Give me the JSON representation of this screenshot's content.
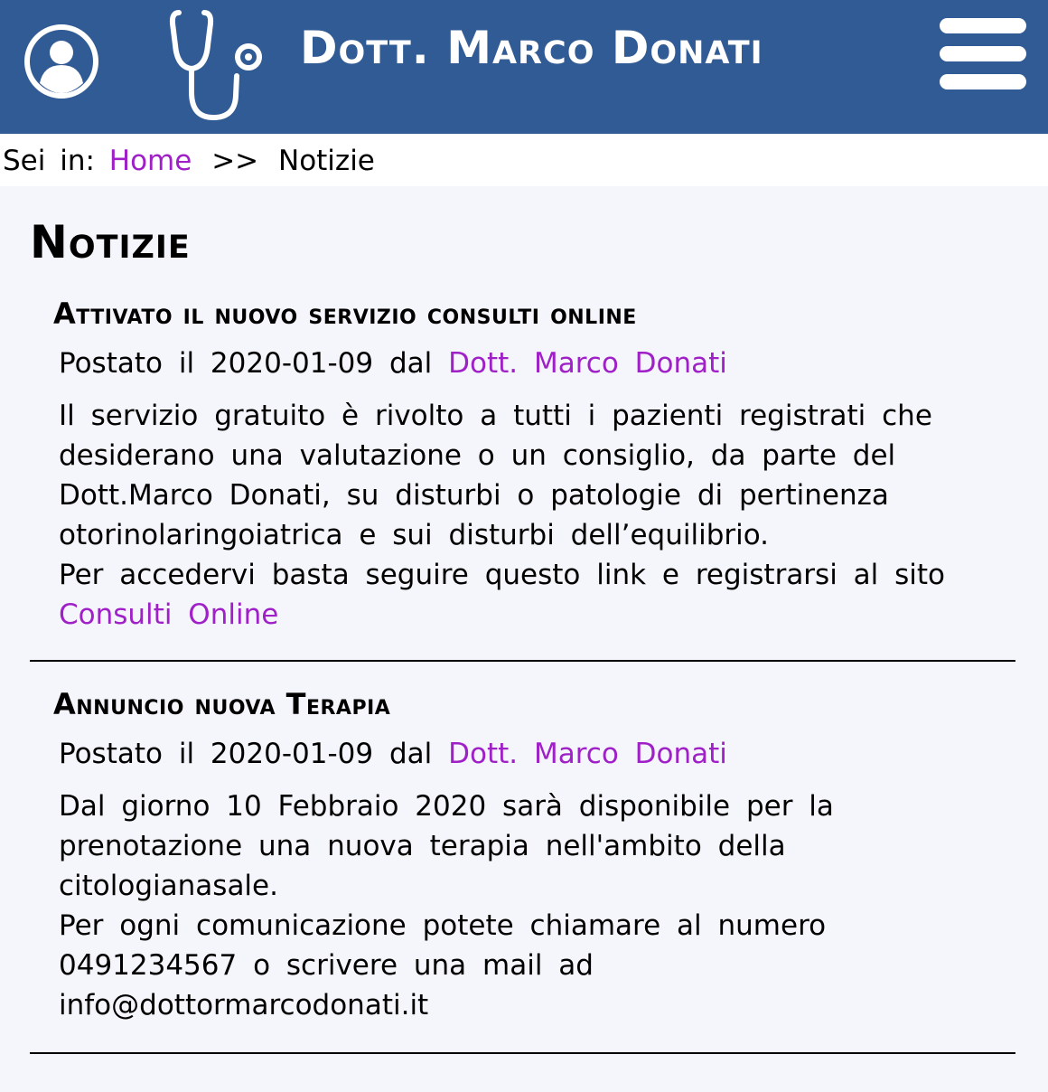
{
  "header": {
    "title": "Dott. Marco Donati",
    "user_icon": "user-avatar-icon",
    "logo_icon": "stethoscope-icon",
    "menu_icon": "hamburger-menu-icon",
    "color": "#315b94"
  },
  "breadcrumb": {
    "prefix": "Sei in:",
    "home": "Home",
    "separator": ">>",
    "current": "Notizie",
    "link_color": "#a020c8"
  },
  "page": {
    "title": "Notizie"
  },
  "articles": [
    {
      "title": "Attivato il nuovo servizio consulti online",
      "posted_prefix": "Postato il",
      "date": "2020-01-09",
      "by": "dal",
      "author": "Dott. Marco Donati",
      "paragraphs": [
        "Il servizio gratuito è rivolto a tutti i pazienti registrati che desiderano una valutazione o un consiglio, da parte del Dott.Marco Donati, su disturbi o patologie di pertinenza otorinolaringoiatrica e sui disturbi dell’equilibrio.",
        "Per accedervi basta seguire questo link e registrarsi al sito"
      ],
      "link": "Consulti Online"
    },
    {
      "title": "Annuncio nuova Terapia",
      "posted_prefix": "Postato il",
      "date": "2020-01-09",
      "by": "dal",
      "author": "Dott. Marco Donati",
      "paragraphs": [
        "Dal giorno 10 Febbraio 2020 sarà disponibile per la prenotazione una nuova terapia nell'ambito della citologianasale.",
        "Per ogni comunicazione potete chiamare al numero 0491234567 o scrivere una mail ad info@dottormarcodonati.it"
      ]
    }
  ]
}
